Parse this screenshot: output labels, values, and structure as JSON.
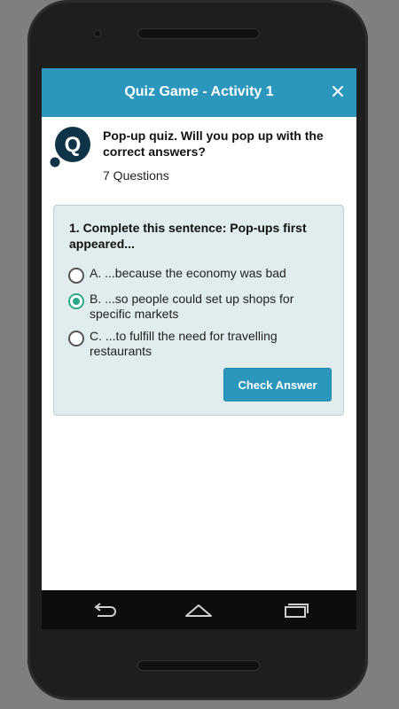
{
  "header": {
    "title": "Quiz Game - Activity 1",
    "close_icon": "close-icon"
  },
  "quiz": {
    "logo_letter": "Q",
    "title": "Pop-up quiz. Will you pop up with the correct answers?",
    "question_count": "7 Questions"
  },
  "question": {
    "text": "1. Complete this sentence: Pop-ups first appeared...",
    "options": [
      {
        "label": "A. ...because the economy was bad",
        "selected": false
      },
      {
        "label": "B. ...so people could set up shops for specific markets",
        "selected": true
      },
      {
        "label": "C. ...to fulfill the need for travelling restaurants",
        "selected": false
      }
    ],
    "check_label": "Check Answer"
  },
  "navbar": {
    "back_icon": "back-icon",
    "home_icon": "home-icon",
    "recents_icon": "recents-icon"
  },
  "colors": {
    "accent": "#2b97bd",
    "radio_selected": "#2aa887",
    "card_bg": "#e0eced",
    "logo": "#0f3347"
  }
}
